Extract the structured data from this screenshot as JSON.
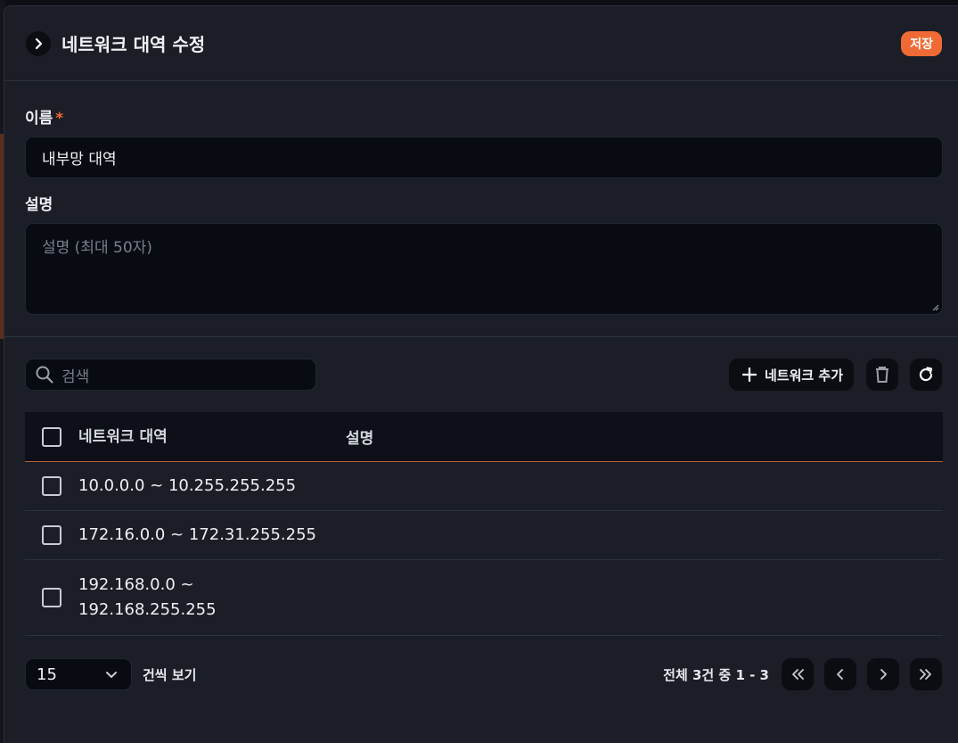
{
  "header": {
    "title": "네트워크 대역 수정",
    "save_label": "저장"
  },
  "form": {
    "name_label": "이름",
    "required_mark": "*",
    "name_value": "내부망 대역",
    "description_label": "설명",
    "description_placeholder": "설명 (최대 50자)"
  },
  "toolbar": {
    "search_placeholder": "검색",
    "add_label": "네트워크 추가"
  },
  "table": {
    "columns": [
      "네트워크 대역",
      "설명"
    ],
    "rows": [
      {
        "range": "10.0.0.0 ~ 10.255.255.255",
        "description": ""
      },
      {
        "range": "172.16.0.0 ~ 172.31.255.255",
        "description": ""
      },
      {
        "range": "192.168.0.0 ~ 192.168.255.255",
        "description": ""
      }
    ]
  },
  "pagination": {
    "page_size": "15",
    "per_page_label": "건씩 보기",
    "summary": "전체 3건 중 1 - 3"
  },
  "colors": {
    "accent": "#ef6a34",
    "panel_bg": "#1b1e27",
    "input_bg": "#080b12"
  }
}
